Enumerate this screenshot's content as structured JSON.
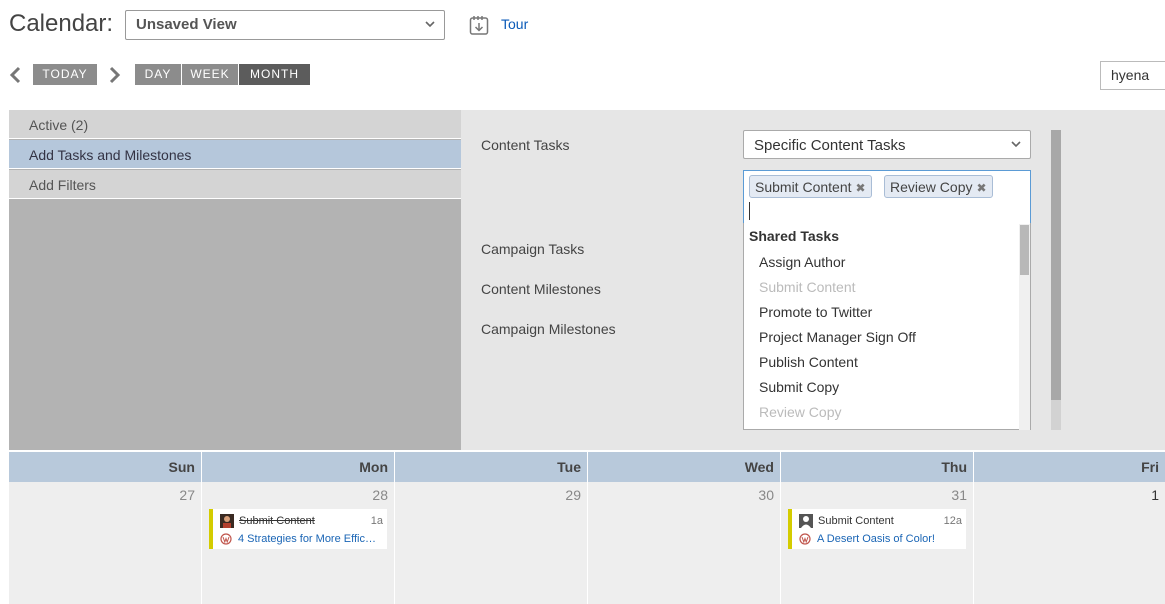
{
  "header": {
    "title": "Calendar:",
    "view_select": "Unsaved View",
    "tour_label": "Tour"
  },
  "nav": {
    "today": "TODAY",
    "day": "DAY",
    "week": "WEEK",
    "month": "MONTH",
    "active_view": "MONTH",
    "search_value": "hyena"
  },
  "filter_panel": {
    "tabs": [
      {
        "label": "Active (2)"
      },
      {
        "label": "Add Tasks and Milestones"
      },
      {
        "label": "Add Filters"
      }
    ],
    "rows": {
      "content_tasks": "Content Tasks",
      "campaign_tasks": "Campaign Tasks",
      "content_milestones": "Content Milestones",
      "campaign_milestones": "Campaign Milestones"
    },
    "task_select": "Specific Content Tasks",
    "tokens": [
      "Submit Content",
      "Review Copy"
    ],
    "token_remove": "✖",
    "dropdown": {
      "group_header": "Shared Tasks",
      "items": [
        {
          "label": "Assign Author",
          "disabled": false
        },
        {
          "label": "Submit Content",
          "disabled": true
        },
        {
          "label": "Promote to Twitter",
          "disabled": false
        },
        {
          "label": "Project Manager Sign Off",
          "disabled": false
        },
        {
          "label": "Publish Content",
          "disabled": false
        },
        {
          "label": "Submit Copy",
          "disabled": false
        },
        {
          "label": "Review Copy",
          "disabled": true
        }
      ]
    }
  },
  "calendar": {
    "days": [
      "Sun",
      "Mon",
      "Tue",
      "Wed",
      "Thu",
      "Fri"
    ],
    "dates": [
      "27",
      "28",
      "29",
      "30",
      "31",
      "1"
    ],
    "events": [
      {
        "title": "Submit Content",
        "time": "1a",
        "link": "4 Strategies for More Effic…",
        "done": true
      },
      {
        "title": "Submit Content",
        "time": "12a",
        "link": "A Desert Oasis of Color!",
        "done": false
      }
    ]
  },
  "colors": {
    "accent_link": "#1a65b5",
    "event_bar": "#d4cc00",
    "selected_tab": "#b5c7db",
    "calendar_header": "#b8c9db"
  }
}
